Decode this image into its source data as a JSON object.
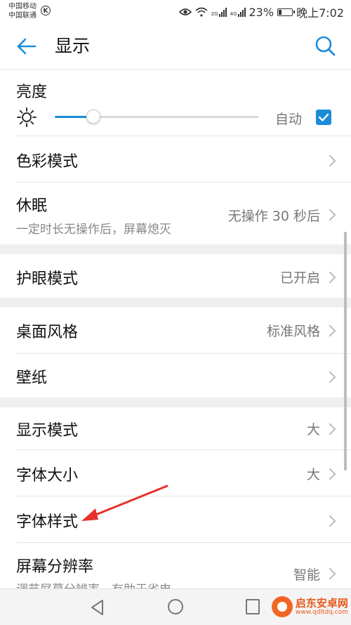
{
  "status": {
    "carrier1": "中国移动",
    "carrier2": "中国联通",
    "k_badge": "K",
    "net2": "2G",
    "net4": "4G",
    "battery": "23%",
    "battery_level": 0.23,
    "time": "晚上7:02"
  },
  "header": {
    "title": "显示"
  },
  "brightness": {
    "title": "亮度",
    "auto_label": "自动",
    "auto_checked": true,
    "level": 0.19
  },
  "items": [
    {
      "title": "色彩模式"
    },
    {
      "title": "休眠",
      "subtitle": "一定时长无操作后，屏幕熄灭",
      "value": "无操作 30 秒后"
    },
    {
      "title": "护眼模式",
      "value": "已开启"
    },
    {
      "title": "桌面风格",
      "value": "标准风格"
    },
    {
      "title": "壁纸"
    },
    {
      "title": "显示模式",
      "value": "大"
    },
    {
      "title": "字体大小",
      "value": "大"
    },
    {
      "title": "字体样式"
    },
    {
      "title": "屏幕分辨率",
      "subtitle": "调节屏幕分辨率，有助于省电",
      "value": "智能"
    }
  ],
  "watermark": {
    "name": "启东安卓网",
    "url": "www.qdltdq.com"
  },
  "colors": {
    "accent": "#1a8cd8",
    "annotation": "#e8312a"
  }
}
